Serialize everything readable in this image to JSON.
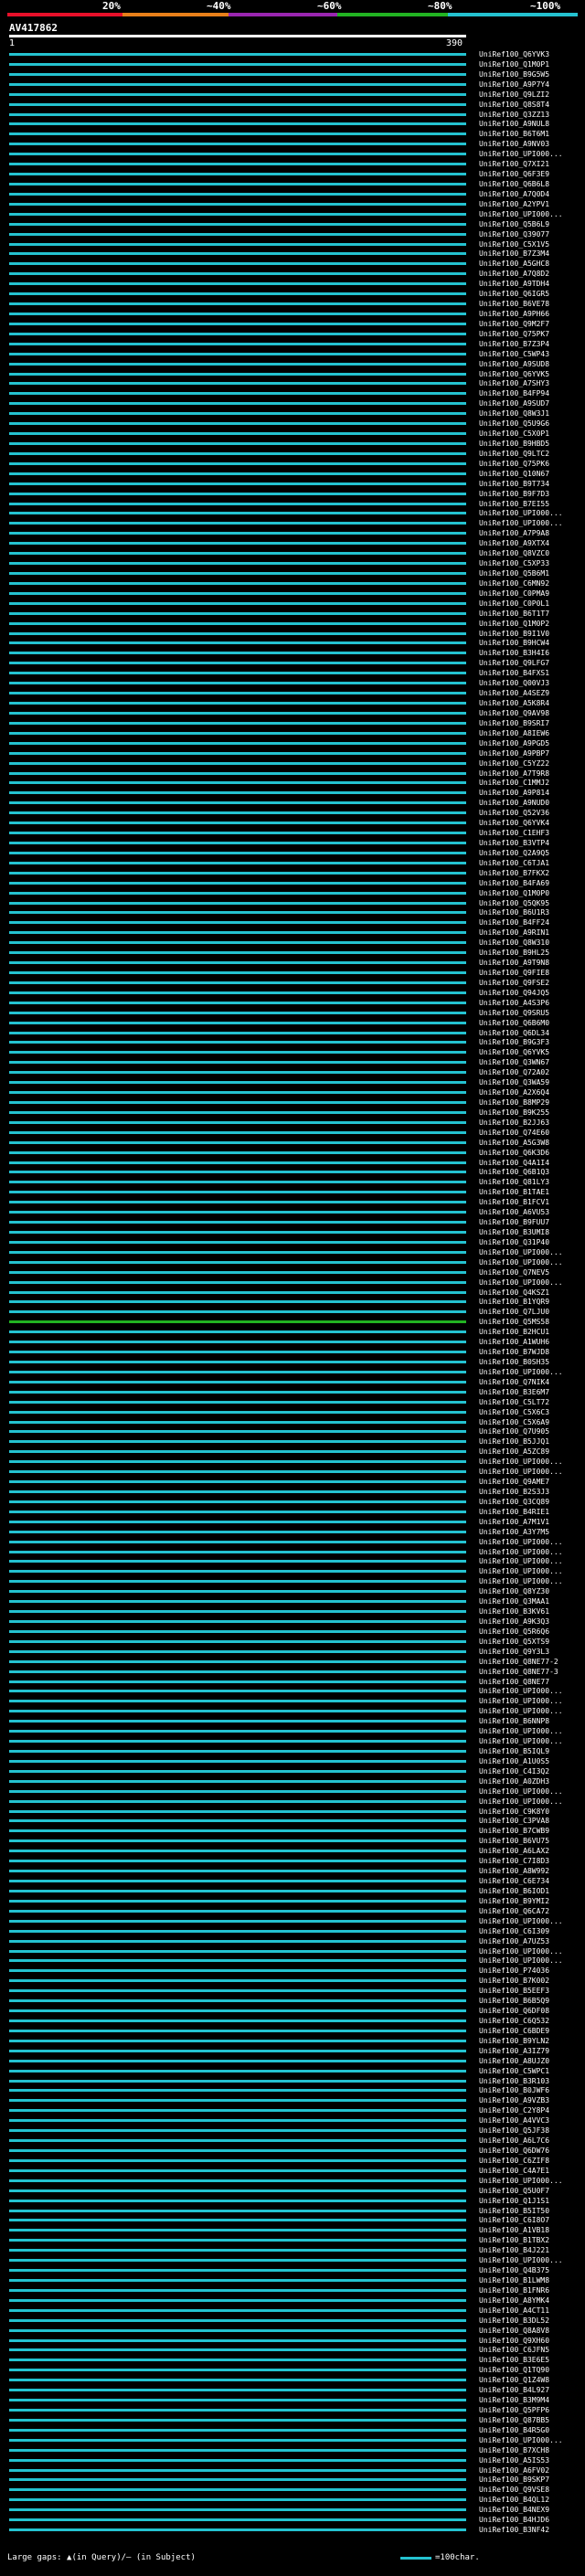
{
  "scale": {
    "labels": [
      "20%",
      "~40%",
      "~60%",
      "~80%",
      "~100%"
    ],
    "colors": [
      "#e8102a",
      "#e8801a",
      "#9a26b0",
      "#22b422",
      "#24c2d0"
    ]
  },
  "query": {
    "id": "AV417862",
    "start": "1",
    "end": "390"
  },
  "colors": {
    "hit_primary": "#24c2d0",
    "hit_low": "#22b422",
    "gap": "#1b6a7a",
    "background": "#000000"
  },
  "hits": [
    "UniRef100_Q6YVK3",
    "UniRef100_Q1M0P1",
    "UniRef100_B9G5W5",
    "UniRef100_A9P7Y4",
    "UniRef100_Q9LZI2",
    "UniRef100_Q8S8T4",
    "UniRef100_Q3ZZ13",
    "UniRef100_A9NUL8",
    "UniRef100_B6T6M1",
    "UniRef100_A9NV03",
    "UniRef100_UPI000...",
    "UniRef100_Q7XI21",
    "UniRef100_Q6F3E9",
    "UniRef100_Q6B6L8",
    "UniRef100_A7Q0D4",
    "UniRef100_A2YPV1",
    "UniRef100_UPI000...",
    "UniRef100_Q5B6L9",
    "UniRef100_Q39077",
    "UniRef100_C5X1V5",
    "UniRef100_B7Z3M4",
    "UniRef100_A5GHC8",
    "UniRef100_A7Q8D2",
    "UniRef100_A9TDH4",
    "UniRef100_Q6IGR5",
    "UniRef100_B6VE78",
    "UniRef100_A9PH66",
    "UniRef100_Q9M2F7",
    "UniRef100_Q75PK7",
    "UniRef100_B7Z3P4",
    "UniRef100_C5WP43",
    "UniRef100_A9SUD8",
    "UniRef100_Q6YVK5",
    "UniRef100_A7SHY3",
    "UniRef100_B4FP94",
    "UniRef100_A9SUD7",
    "UniRef100_Q8W3J1",
    "UniRef100_Q5U9G6",
    "UniRef100_C5X0P1",
    "UniRef100_B9HBD5",
    "UniRef100_Q9LTC2",
    "UniRef100_Q75PK6",
    "UniRef100_Q10N67",
    "UniRef100_B9T734",
    "UniRef100_B9F7D3",
    "UniRef100_B7EI55",
    "UniRef100_UPI000...",
    "UniRef100_UPI000...",
    "UniRef100_A7P9A8",
    "UniRef100_A9XTX4",
    "UniRef100_Q8VZC0",
    "UniRef100_C5XP33",
    "UniRef100_Q5B6M1",
    "UniRef100_C6MN92",
    "UniRef100_C0PMA9",
    "UniRef100_C0P0L1",
    "UniRef100_B6T1T7",
    "UniRef100_Q1M0P2",
    "UniRef100_B9I1V0",
    "UniRef100_B9HCW4",
    "UniRef100_B3H4I6",
    "UniRef100_Q9LFG7",
    "UniRef100_B4FXS1",
    "UniRef100_Q00VJ3",
    "UniRef100_A4SEZ9",
    "UniRef100_A5K8R4",
    "UniRef100_Q9AV98",
    "UniRef100_B9SRI7",
    "UniRef100_A8IEW6",
    "UniRef100_A9PGD5",
    "UniRef100_A9PBP7",
    "UniRef100_C5YZ22",
    "UniRef100_A7T9R8",
    "UniRef100_C1MMJ2",
    "UniRef100_A9P814",
    "UniRef100_A9NUD0",
    "UniRef100_Q52V36",
    "UniRef100_Q6YVK4",
    "UniRef100_C1EHF3",
    "UniRef100_B3VTP4",
    "UniRef100_Q2A9Q5",
    "UniRef100_C6TJA1",
    "UniRef100_B7FKX2",
    "UniRef100_B4FA69",
    "UniRef100_Q1M0P0",
    "UniRef100_Q5QK95",
    "UniRef100_B6U1R3",
    "UniRef100_B4FF24",
    "UniRef100_A9RIN1",
    "UniRef100_Q8W310",
    "UniRef100_B9HL25",
    "UniRef100_A9T9N8",
    "UniRef100_Q9FIE8",
    "UniRef100_Q9FSE2",
    "UniRef100_Q94JQ5",
    "UniRef100_A4S3P6",
    "UniRef100_Q9SRU5",
    "UniRef100_Q6B6M0",
    "UniRef100_Q6DL34",
    "UniRef100_B9G3F3",
    "UniRef100_Q6YVK5",
    "UniRef100_Q3WN67",
    "UniRef100_Q72A02",
    "UniRef100_Q3WA59",
    "UniRef100_A2X6Q4",
    "UniRef100_B8MP29",
    "UniRef100_B9K255",
    "UniRef100_B2JJ63",
    "UniRef100_Q74E60",
    "UniRef100_A5G3W8",
    "UniRef100_Q6K3D6",
    "UniRef100_Q4A1I4",
    "UniRef100_Q6B1Q3",
    "UniRef100_Q81LY3",
    "UniRef100_B1TAE1",
    "UniRef100_B1FCV1",
    "UniRef100_A6VU53",
    "UniRef100_B9FUU7",
    "UniRef100_B3UMI8",
    "UniRef100_Q31P40",
    "UniRef100_UPI000...",
    "UniRef100_UPI000...",
    "UniRef100_Q7NEV5",
    "UniRef100_UPI000...",
    "UniRef100_Q4KSZ1",
    "UniRef100_B1YQR9",
    "UniRef100_Q7LJU0",
    "UniRef100_Q5MS58",
    "UniRef100_B2HCU1",
    "UniRef100_A1WUH6",
    "UniRef100_B7WJD8",
    "UniRef100_B0SH35",
    "UniRef100_UPI000...",
    "UniRef100_Q7NIK4",
    "UniRef100_B3E6M7",
    "UniRef100_C5LT72",
    "UniRef100_C5X6C3",
    "UniRef100_C5X6A9",
    "UniRef100_Q7U905",
    "UniRef100_B5JJQ1",
    "UniRef100_A5ZC89",
    "UniRef100_UPI000...",
    "UniRef100_UPI000...",
    "UniRef100_Q9AME7",
    "UniRef100_B2S3J3",
    "UniRef100_Q3CQ89",
    "UniRef100_B4RIE1",
    "UniRef100_A7M1V1",
    "UniRef100_A3Y7M5",
    "UniRef100_UPI000...",
    "UniRef100_UPI000...",
    "UniRef100_UPI000...",
    "UniRef100_UPI000...",
    "UniRef100_UPI000...",
    "UniRef100_Q8YZ30",
    "UniRef100_Q3MAA1",
    "UniRef100_B3KV61",
    "UniRef100_A9K3Q3",
    "UniRef100_Q5R6Q6",
    "UniRef100_Q5XTS9",
    "UniRef100_Q9Y3L3",
    "UniRef100_Q8NE77-2",
    "UniRef100_Q8NE77-3",
    "UniRef100_Q8NE77",
    "UniRef100_UPI000...",
    "UniRef100_UPI000...",
    "UniRef100_UPI000...",
    "UniRef100_B6NNP8",
    "UniRef100_UPI000...",
    "UniRef100_UPI000...",
    "UniRef100_B5IQL9",
    "UniRef100_A1U0S5",
    "UniRef100_C4I3Q2",
    "UniRef100_A0ZDH3",
    "UniRef100_UPI000...",
    "UniRef100_UPI000...",
    "UniRef100_C9K8Y0",
    "UniRef100_C3PVA8",
    "UniRef100_B7CWB9",
    "UniRef100_B6VU75",
    "UniRef100_A6LAX2",
    "UniRef100_C7I8D3",
    "UniRef100_A8W992",
    "UniRef100_C6E734",
    "UniRef100_B6IOD1",
    "UniRef100_B9YMI2",
    "UniRef100_Q6CA72",
    "UniRef100_UPI000...",
    "UniRef100_C6I309",
    "UniRef100_A7UZ53",
    "UniRef100_UPI000...",
    "UniRef100_UPI000...",
    "UniRef100_P74036",
    "UniRef100_B7K002",
    "UniRef100_B5EEF3",
    "UniRef100_B6B5Q9",
    "UniRef100_Q6DF08",
    "UniRef100_C6Q532",
    "UniRef100_C6BDE9",
    "UniRef100_B9YLN2",
    "UniRef100_A3IZ79",
    "UniRef100_A8UJZ0",
    "UniRef100_C5WPC1",
    "UniRef100_B3R103",
    "UniRef100_B0JWF6",
    "UniRef100_A9VZB3",
    "UniRef100_C2Y8P4",
    "UniRef100_A4VVC3",
    "UniRef100_Q5JF38",
    "UniRef100_A6L7C6",
    "UniRef100_Q6DW76",
    "UniRef100_C6ZIF8",
    "UniRef100_C4A7E1",
    "UniRef100_UPI000...",
    "UniRef100_Q5U0F7",
    "UniRef100_Q1J1S1",
    "UniRef100_B5IT50",
    "UniRef100_C6I8O7",
    "UniRef100_A1VB18",
    "UniRef100_B1TBX2",
    "UniRef100_B4J221",
    "UniRef100_UPI000...",
    "UniRef100_Q4B375",
    "UniRef100_B1LWM8",
    "UniRef100_B1FNR6",
    "UniRef100_A8YMK4",
    "UniRef100_A4CT11",
    "UniRef100_B3DL52",
    "UniRef100_Q8A8V8",
    "UniRef100_Q9XH60",
    "UniRef100_C6JFN5",
    "UniRef100_B3E6E5",
    "UniRef100_Q1TQ90",
    "UniRef100_Q1Z4W8",
    "UniRef100_B4L927",
    "UniRef100_B3M9M4",
    "UniRef100_Q5PFP6",
    "UniRef100_Q87BB5",
    "UniRef100_B4R5G0",
    "UniRef100_UPI000...",
    "UniRef100_B7XCH8",
    "UniRef100_A5IS53",
    "UniRef100_A6FV02",
    "UniRef100_B9SKP7",
    "UniRef100_Q9VSE8",
    "UniRef100_B4QL12",
    "UniRef100_B4NEX9",
    "UniRef100_B4HJD6",
    "UniRef100_B3NF42"
  ],
  "legend": {
    "gaps_text": "Large gaps: ▲(in Query)/– (in Subject)",
    "scale_text": "=100char."
  }
}
